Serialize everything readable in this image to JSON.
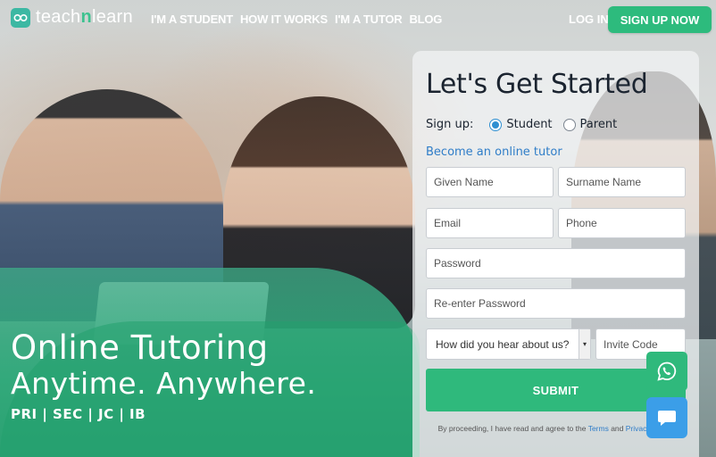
{
  "brand": {
    "logo_pre": "teach",
    "logo_n": "n",
    "logo_post": "learn"
  },
  "nav": {
    "links": [
      "I'M A STUDENT",
      "HOW IT WORKS",
      "I'M A TUTOR",
      "BLOG"
    ],
    "login": "LOG IN",
    "signup": "SIGN UP NOW"
  },
  "hero": {
    "headline1": "Online Tutoring",
    "headline2": "Anytime. Anywhere.",
    "levels": "PRI | SEC | JC | IB"
  },
  "form": {
    "title": "Let's Get Started",
    "signup_label": "Sign up:",
    "role_options": [
      "Student",
      "Parent"
    ],
    "selected_role": "Student",
    "become_tutor": "Become an online tutor",
    "placeholders": {
      "given_name": "Given Name",
      "surname": "Surname Name",
      "email": "Email",
      "phone": "Phone",
      "password": "Password",
      "repassword": "Re-enter Password",
      "invite": "Invite Code"
    },
    "hear_about": "How did you hear about us?",
    "submit": "SUBMIT",
    "terms_pre": "By proceeding, I have read and agree to the",
    "terms_link": "Terms",
    "terms_and": "and",
    "privacy_link": "Privacy Policy."
  },
  "colors": {
    "accent_green": "#2fb97c",
    "link_blue": "#2f7dc8",
    "chat_blue": "#3b9ee8"
  }
}
